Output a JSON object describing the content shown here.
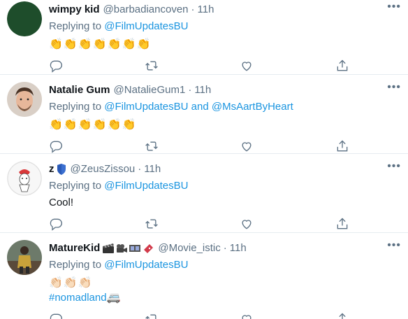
{
  "tweets": [
    {
      "name": "wimpy kid",
      "handle": "@barbadiancoven",
      "dot": "·",
      "time": "11h",
      "reply_prefix": "Replying to",
      "mentions": [
        "@FilmUpdatesBU"
      ],
      "emoji": [
        "👏",
        "👏",
        "👏",
        "👏",
        "👏",
        "👏",
        "👏"
      ],
      "avatar_color": "#1e4d2b"
    },
    {
      "name": "Natalie Gum",
      "handle": "@NatalieGum1",
      "dot": "·",
      "time": "11h",
      "reply_prefix": "Replying to",
      "mentions": [
        "@FilmUpdatesBU",
        "@MsAartByHeart"
      ],
      "reply_join": "and",
      "emoji": [
        "👏",
        "👏",
        "👏",
        "👏",
        "👏",
        "👏"
      ]
    },
    {
      "name": "z",
      "handle": "@ZeusZissou",
      "dot": "·",
      "time": "11h",
      "reply_prefix": "Replying to",
      "mentions": [
        "@FilmUpdatesBU"
      ],
      "text": "Cool!"
    },
    {
      "name": "MatureKid",
      "handle": "@Movie_istic",
      "dot": "·",
      "time": "11h",
      "reply_prefix": "Replying to",
      "mentions": [
        "@FilmUpdatesBU"
      ],
      "emoji": [
        "👏🏻",
        "👏🏻",
        "👏🏻"
      ],
      "hashtag": "#nomadland",
      "hashtag_suffix": "🚐"
    }
  ],
  "more_label": "•••",
  "colors": {
    "link": "#1b95e0",
    "muted": "#5b7083",
    "divider": "#e6ecf0",
    "clap": "#f4c542"
  },
  "icons": [
    "reply-icon",
    "retweet-icon",
    "like-icon",
    "share-icon"
  ]
}
